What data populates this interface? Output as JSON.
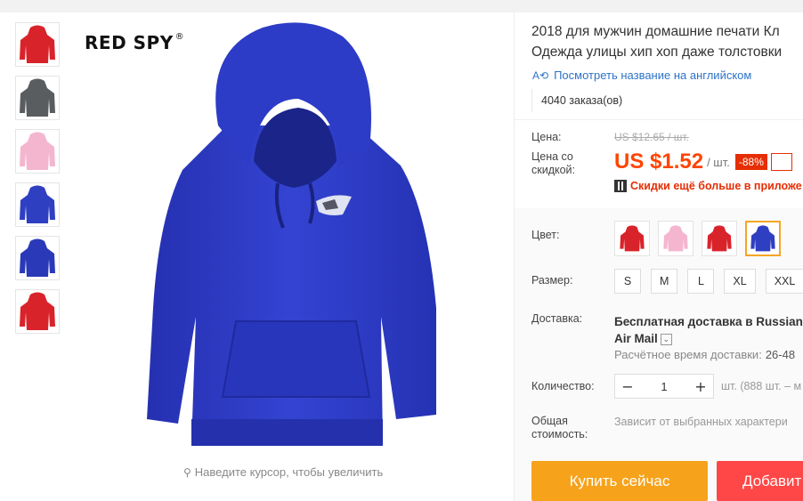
{
  "brand": {
    "name": "RED SPY",
    "mark": "®"
  },
  "zoom_hint": "Наведите курсор, чтобы увеличить",
  "thumbnails": [
    {
      "color": "#d9232b"
    },
    {
      "color": "#5a5d60"
    },
    {
      "color": "#f4b6cf"
    },
    {
      "color": "#2f3fc2"
    },
    {
      "color": "#2a39b8"
    },
    {
      "color": "#d9232b"
    }
  ],
  "product": {
    "title_line1": "2018 для мужчин домашние печати Кл",
    "title_line2": "Одежда улицы хип хоп даже толстовки",
    "translate_link": "Посмотреть название на английском",
    "orders": "4040 заказа(ов)"
  },
  "price": {
    "label": "Цена:",
    "old": "US $12.65 / шт.",
    "discount_label": "Цена со скидкой:",
    "current": "US $1.52",
    "unit": "/ шт.",
    "discount": "-88%",
    "app_promo": "Скидки ещё больше в приложе"
  },
  "options": {
    "color_label": "Цвет:",
    "colors": [
      {
        "color": "#d9232b",
        "selected": false
      },
      {
        "color": "#f4b6cf",
        "selected": false
      },
      {
        "color": "#d9232b",
        "selected": false
      },
      {
        "color": "#2f3fc2",
        "selected": true
      }
    ],
    "size_label": "Размер:",
    "sizes": [
      "S",
      "M",
      "L",
      "XL",
      "XXL"
    ]
  },
  "shipping": {
    "label": "Доставка:",
    "line1": "Бесплатная доставка в Russian",
    "line2": "Air Mail",
    "time_label": "Расчётное время доставки:",
    "time_value": "26-48"
  },
  "quantity": {
    "label": "Количество:",
    "value": "1",
    "note": "шт. (888 шт. – м"
  },
  "total": {
    "label": "Общая стоимость:",
    "note": "Зависит от выбранных характери"
  },
  "actions": {
    "buy": "Купить сейчас",
    "add": "Добавит"
  }
}
